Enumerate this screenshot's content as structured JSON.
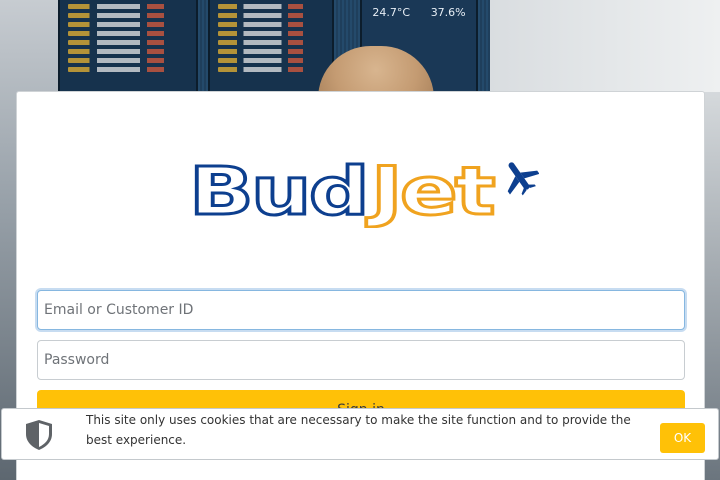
{
  "brand": {
    "name_part1": "Bud",
    "name_part2": "Jet",
    "color_primary": "#0d3f8f",
    "color_accent": "#f0a31f",
    "icon": "airplane-icon"
  },
  "background": {
    "display_temperature": "24.7°C",
    "display_humidity": "37.6%"
  },
  "login": {
    "email_placeholder": "Email or Customer ID",
    "email_value": "",
    "password_placeholder": "Password",
    "password_value": "",
    "signin_label": "Sign in",
    "button_color": "#ffc107"
  },
  "cookie_banner": {
    "icon": "shield-icon",
    "message": "This site only uses cookies that are necessary to make the site function and to provide the best experience.",
    "ok_label": "OK"
  }
}
